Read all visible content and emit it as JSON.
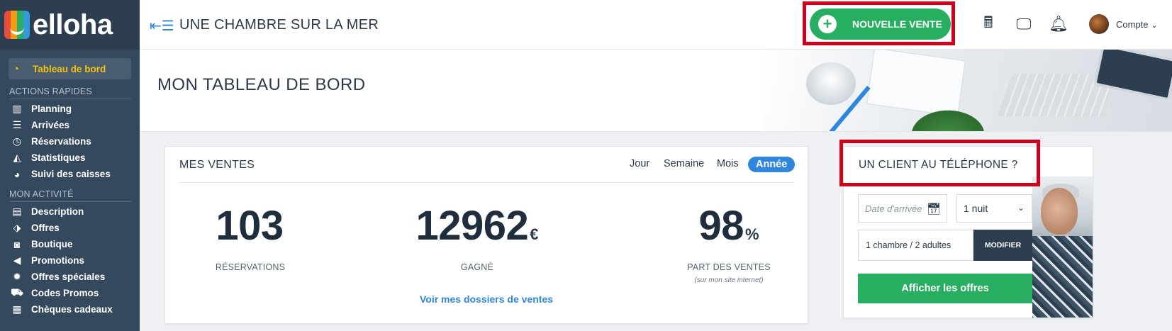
{
  "brand": {
    "logo_text": "elloha"
  },
  "sidebar": {
    "active_item": {
      "label": "Tableau de bord",
      "icon": "dashboard-icon"
    },
    "sections": [
      {
        "title": "ACTIONS RAPIDES",
        "items": [
          {
            "label": "Planning",
            "icon": "bar-chart-icon"
          },
          {
            "label": "Arrivées",
            "icon": "sliders-icon"
          },
          {
            "label": "Réservations",
            "icon": "clock-icon"
          },
          {
            "label": "Statistiques",
            "icon": "area-chart-icon"
          },
          {
            "label": "Suivi des caisses",
            "icon": "pie-chart-icon"
          }
        ]
      },
      {
        "title": "MON ACTIVITÉ",
        "items": [
          {
            "label": "Description",
            "icon": "briefcase-icon"
          },
          {
            "label": "Offres",
            "icon": "tags-icon"
          },
          {
            "label": "Boutique",
            "icon": "shopping-bag-icon"
          },
          {
            "label": "Promotions",
            "icon": "megaphone-icon"
          },
          {
            "label": "Offres spéciales",
            "icon": "badge-icon"
          },
          {
            "label": "Codes Promos",
            "icon": "cart-icon"
          },
          {
            "label": "Chèques cadeaux",
            "icon": "voucher-icon"
          }
        ]
      }
    ]
  },
  "header": {
    "hotel_name": "UNE CHAMBRE SUR LA MER",
    "new_sale_label": "NOUVELLE VENTE",
    "account_label": "Compte"
  },
  "banner": {
    "title": "MON TABLEAU DE BORD"
  },
  "sales": {
    "title": "MES VENTES",
    "periods": [
      "Jour",
      "Semaine",
      "Mois",
      "Année"
    ],
    "active_period": "Année",
    "kpis": [
      {
        "value": "103",
        "unit": "",
        "label": "RÉSERVATIONS",
        "sub": ""
      },
      {
        "value": "12962",
        "unit": "€",
        "label": "GAGNÉ",
        "sub": ""
      },
      {
        "value": "98",
        "unit": "%",
        "label": "PART DES VENTES",
        "sub": "(sur mon site internet)"
      }
    ],
    "link_label": "Voir mes dossiers de ventes"
  },
  "phone_client": {
    "title": "UN CLIENT AU TÉLÉPHONE ?",
    "date_placeholder": "Date d'arrivée",
    "nights_value": "1 nuit",
    "guests_value": "1 chambre / 2 adultes",
    "modify_label": "MODIFIER",
    "offers_label": "Afficher les offres"
  },
  "colors": {
    "sidebar_bg": "#34495e",
    "active_yellow": "#f1c40f",
    "green": "#27ae60",
    "blue": "#2e86de",
    "highlight_red": "#d0021b"
  }
}
